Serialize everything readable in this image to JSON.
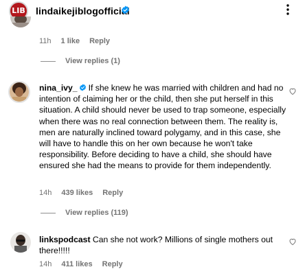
{
  "header": {
    "logo_text": "LIB",
    "username": "lindaikejiblogofficial",
    "verified_icon": "verified-badge-icon",
    "more_icon": "more-options-icon"
  },
  "comment_top": {
    "partial_name": "_",
    "time": "11h",
    "likes": "1 like",
    "reply": "Reply",
    "view_replies": "View replies (1)"
  },
  "comment_nina": {
    "username": "nina_ivy_",
    "text": "If she knew he was married with children and had no intention of claiming her or the child, then she put herself in this situation. A child should never be used to trap someone, especially when there was no real connection between them. The reality is, men are naturally inclined toward polygamy, and in this case, she will have to handle this on her own because he won't take responsibility. Before deciding to have a child, she should have ensured she had the means to provide for them independently.",
    "time": "14h",
    "likes": "439 likes",
    "reply": "Reply",
    "view_replies": "View replies (119)"
  },
  "comment_links": {
    "username": "linkspodcast",
    "text": "Can she not work? Millions of single mothers out there!!!!!",
    "time": "14h",
    "likes": "411 likes",
    "reply": "Reply"
  },
  "colors": {
    "brand": "#b3181d",
    "verified": "#0095f6",
    "muted": "#737373"
  }
}
